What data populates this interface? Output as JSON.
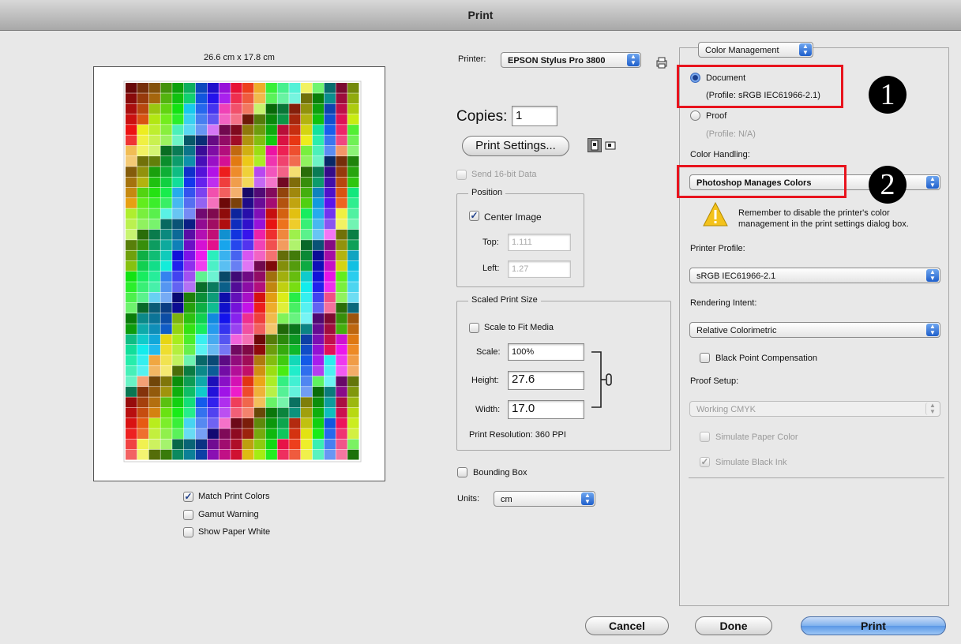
{
  "window": {
    "title": "Print"
  },
  "preview": {
    "size_label": "26.6 cm x 17.8 cm",
    "colors": [
      "#b00018",
      "#d22a1c",
      "#ee6a10",
      "#f6a50c",
      "#2b0a0f",
      "#7a1a12",
      "#0c2a55",
      "#182a7c",
      "#7b7d14",
      "#d0e018",
      "#1a7d1a",
      "#10a845",
      "#10d86a",
      "#e83a7a",
      "#1a1a6a",
      "#3a8a3a",
      "#f23a3a",
      "#faf03a"
    ]
  },
  "preview_options": {
    "match_print_colors": {
      "label": "Match Print Colors",
      "checked": true
    },
    "gamut_warning": {
      "label": "Gamut Warning",
      "checked": false
    },
    "show_paper_white": {
      "label": "Show Paper White",
      "checked": false
    }
  },
  "printer": {
    "label": "Printer:",
    "value": "EPSON Stylus Pro 3800"
  },
  "copies": {
    "label": "Copies:",
    "value": "1"
  },
  "print_settings_button": "Print Settings...",
  "send_16bit": {
    "label": "Send 16-bit Data",
    "checked": false
  },
  "position": {
    "legend": "Position",
    "center_image": {
      "label": "Center Image",
      "checked": true
    },
    "top_label": "Top:",
    "top_value": "1.111",
    "left_label": "Left:",
    "left_value": "1.27"
  },
  "scaled": {
    "legend": "Scaled Print Size",
    "scale_to_fit": {
      "label": "Scale to Fit Media",
      "checked": false
    },
    "scale_label": "Scale:",
    "scale_value": "100%",
    "height_label": "Height:",
    "height_value": "27.6",
    "width_label": "Width:",
    "width_value": "17.0",
    "resolution": "Print Resolution: 360 PPI"
  },
  "bounding_box": {
    "label": "Bounding Box",
    "checked": false
  },
  "units": {
    "label": "Units:",
    "value": "cm"
  },
  "color_mgmt": {
    "section_popup": "Color Management",
    "document_label": "Document",
    "document_profile": "(Profile: sRGB IEC61966-2.1)",
    "proof_label": "Proof",
    "proof_profile": "(Profile: N/A)",
    "color_handling_label": "Color Handling:",
    "color_handling_value": "Photoshop Manages Colors",
    "warning_text_1": "Remember to disable the printer's color",
    "warning_text_2": "management in the print settings dialog box.",
    "printer_profile_label": "Printer Profile:",
    "printer_profile_value": "sRGB IEC61966-2.1",
    "rendering_intent_label": "Rendering Intent:",
    "rendering_intent_value": "Relative Colorimetric",
    "black_point": {
      "label": "Black Point Compensation",
      "checked": false
    },
    "proof_setup_label": "Proof Setup:",
    "proof_setup_value": "Working CMYK",
    "simulate_paper": {
      "label": "Simulate Paper Color",
      "checked": false
    },
    "simulate_black": {
      "label": "Simulate Black Ink",
      "checked": true
    }
  },
  "annotations": {
    "badge_1": "1",
    "badge_2": "2",
    "highlight_color": "#e8131d"
  },
  "buttons": {
    "cancel": "Cancel",
    "done": "Done",
    "print": "Print"
  }
}
